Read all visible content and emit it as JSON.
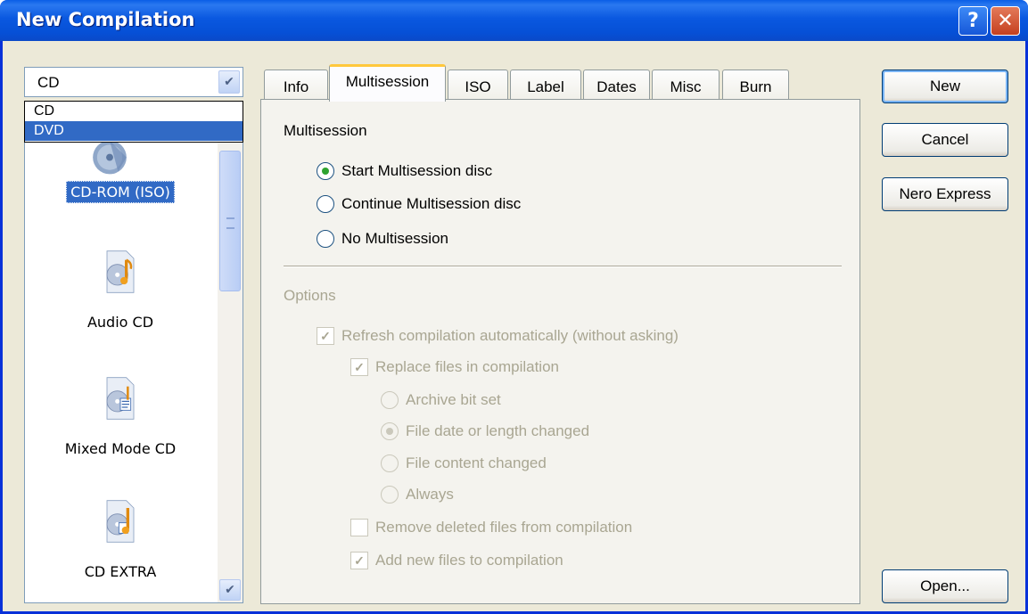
{
  "window": {
    "title": "New Compilation"
  },
  "titlebar_buttons": {
    "help": "?",
    "close": "✕"
  },
  "disc_type": {
    "selected": "CD",
    "options": [
      "CD",
      "DVD"
    ],
    "highlighted_option": "DVD"
  },
  "compilation_types": [
    {
      "label": "CD-ROM (ISO)",
      "icon": "cd-rom-icon",
      "selected": true
    },
    {
      "label": "Audio CD",
      "icon": "audio-cd-icon",
      "selected": false
    },
    {
      "label": "Mixed Mode CD",
      "icon": "mixed-mode-cd-icon",
      "selected": false
    },
    {
      "label": "CD EXTRA",
      "icon": "cd-extra-icon",
      "selected": false
    }
  ],
  "tabs": [
    {
      "label": "Info",
      "active": false
    },
    {
      "label": "Multisession",
      "active": true
    },
    {
      "label": "ISO",
      "active": false
    },
    {
      "label": "Label",
      "active": false
    },
    {
      "label": "Dates",
      "active": false
    },
    {
      "label": "Misc",
      "active": false
    },
    {
      "label": "Burn",
      "active": false
    }
  ],
  "multisession": {
    "group_label": "Multisession",
    "options": [
      {
        "label": "Start Multisession disc",
        "checked": true
      },
      {
        "label": "Continue Multisession disc",
        "checked": false
      },
      {
        "label": "No Multisession",
        "checked": false
      }
    ]
  },
  "options": {
    "group_label": "Options",
    "refresh": {
      "label": "Refresh compilation automatically (without asking)",
      "checked": true
    },
    "replace": {
      "label": "Replace files in compilation",
      "checked": true
    },
    "replace_modes": [
      {
        "label": "Archive bit set",
        "checked": false
      },
      {
        "label": "File date or length changed",
        "checked": true
      },
      {
        "label": "File content changed",
        "checked": false
      },
      {
        "label": "Always",
        "checked": false
      }
    ],
    "remove_deleted": {
      "label": "Remove deleted files from compilation",
      "checked": false
    },
    "add_new": {
      "label": "Add new files to compilation",
      "checked": true
    }
  },
  "buttons": {
    "new": "New",
    "cancel": "Cancel",
    "nero_express": "Nero Express",
    "open": "Open..."
  },
  "colors": {
    "title_bar": "#0a58e0",
    "selection": "#316ac5",
    "dialog_bg": "#ece9d8",
    "tab_highlight": "#ffc83c",
    "disabled_text": "#a9a692"
  }
}
